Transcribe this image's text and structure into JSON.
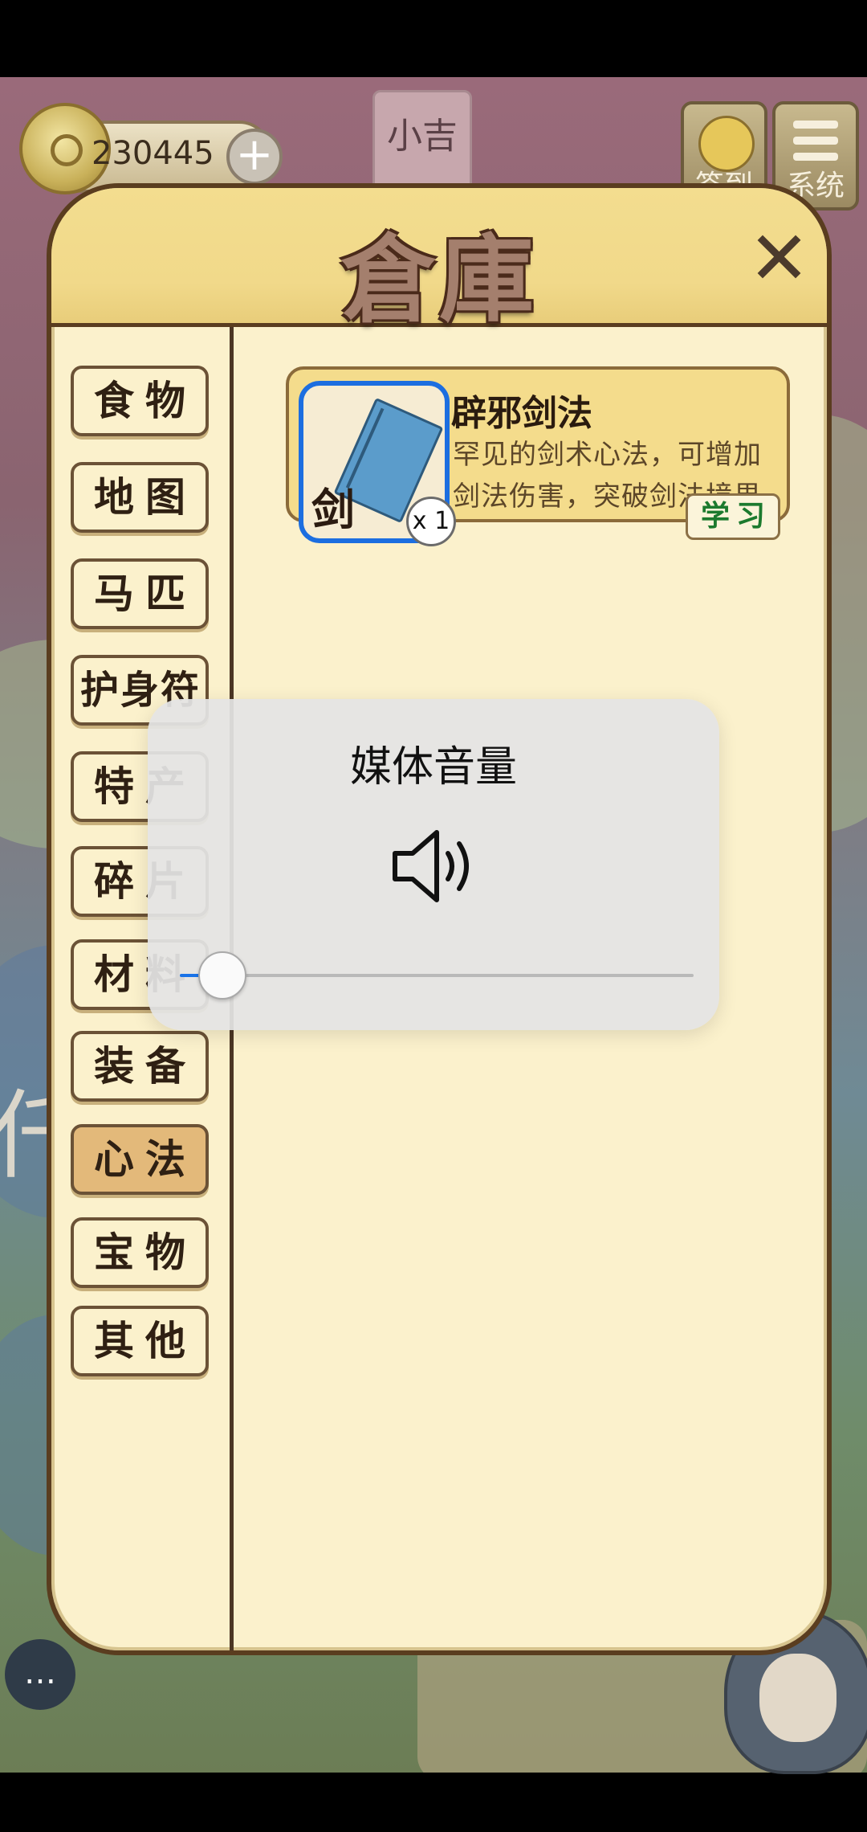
{
  "hud": {
    "coins": "230445",
    "plus": "+",
    "player_name": "小吉",
    "sign_in_label": "签到",
    "system_label": "系统"
  },
  "background_text": "仟",
  "warehouse": {
    "title": "倉庫",
    "close": "✕",
    "categories": [
      {
        "label": "食物",
        "active": false
      },
      {
        "label": "地图",
        "active": false
      },
      {
        "label": "马匹",
        "active": false
      },
      {
        "label": "护身符",
        "active": false
      },
      {
        "label": "特产",
        "active": false
      },
      {
        "label": "碎片",
        "active": false
      },
      {
        "label": "材料",
        "active": false
      },
      {
        "label": "装备",
        "active": false
      },
      {
        "label": "心法",
        "active": true
      },
      {
        "label": "宝物",
        "active": false
      },
      {
        "label": "其他",
        "active": false
      }
    ],
    "item": {
      "icon_char": "剑",
      "quantity": "x 1",
      "name": "辟邪剑法",
      "description": "罕见的剑术心法，可增加剑法伤害，突破剑法境界",
      "action": "学习"
    }
  },
  "volume_popup": {
    "title": "媒体音量",
    "icon": "speaker-icon",
    "level": 0.08,
    "accent": "#1a73e8"
  },
  "bottom": {
    "chat_icon": "chat-bubble-icon"
  }
}
